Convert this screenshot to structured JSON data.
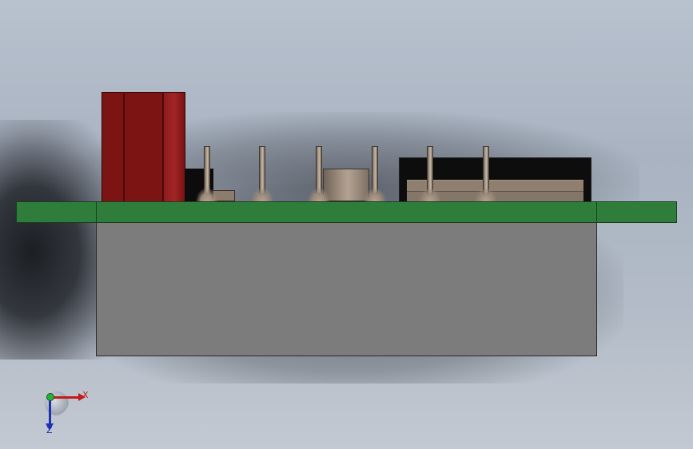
{
  "view": {
    "type": "3d-cad-model-viewport",
    "background_color": "#b1bbc8"
  },
  "model": {
    "colors": {
      "pcb": "#2f7d3b",
      "base": "#7c7c7c",
      "connector_red": "#7d1414",
      "component_black": "#0d0d0d",
      "pins": "#a49484"
    },
    "pin_count": 6
  },
  "triad": {
    "x_label": "X",
    "z_label": "Z",
    "x_color": "#c11b1b",
    "y_color": "#27b03a",
    "z_color": "#1d2fb5"
  }
}
